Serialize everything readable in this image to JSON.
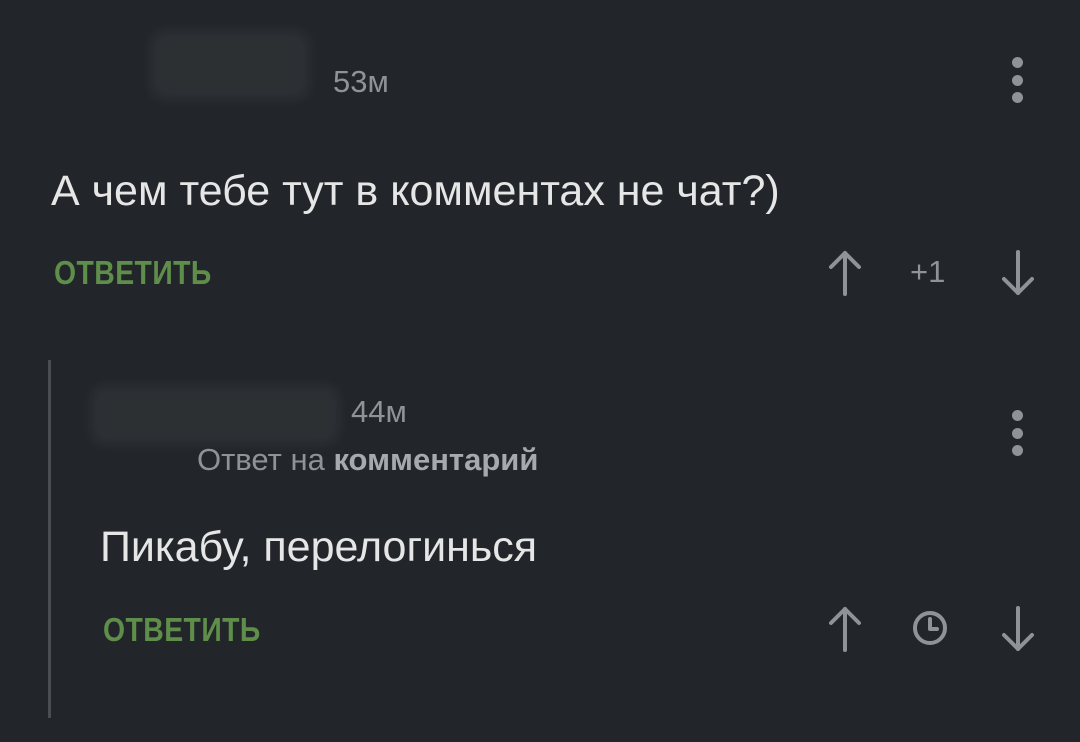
{
  "comments": [
    {
      "time": "53м",
      "text": "А чем тебе тут в комментах не чат?)",
      "reply_label": "ОТВЕТИТЬ",
      "score": "+1"
    },
    {
      "time": "44м",
      "reply_prefix": "Ответ на",
      "reply_target": "комментарий",
      "text": "Пикабу, перелогинься",
      "reply_label": "ОТВЕТИТЬ"
    }
  ],
  "icons": {
    "upvote": "arrow-up-icon",
    "downvote": "arrow-down-icon",
    "menu": "more-vertical-icon",
    "pending_score": "clock-icon"
  },
  "colors": {
    "background": "#222529",
    "reply_button": "#5f8e4a",
    "muted_text": "#8f9398",
    "thread_line": "#4a4e53"
  }
}
